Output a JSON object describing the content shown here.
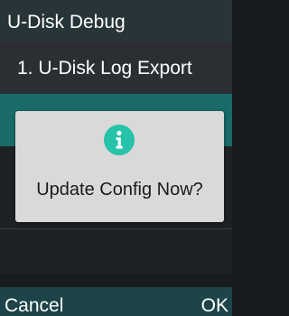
{
  "title_bar": {
    "title": "U-Disk Debug"
  },
  "menu": {
    "items": [
      {
        "label": "1. U-Disk Log Export",
        "selected": false
      },
      {
        "label": "",
        "selected": true
      }
    ]
  },
  "dialog": {
    "icon": "info-icon",
    "message": "Update Config Now?"
  },
  "softkeys": {
    "left_label": "Cancel",
    "right_label": "OK"
  },
  "colors": {
    "title_bar": "#273538",
    "selected_row": "#196a69",
    "dialog_background": "#d9d9d9",
    "info_icon": "#27c2aa",
    "softkey_bar": "#1c4449"
  }
}
